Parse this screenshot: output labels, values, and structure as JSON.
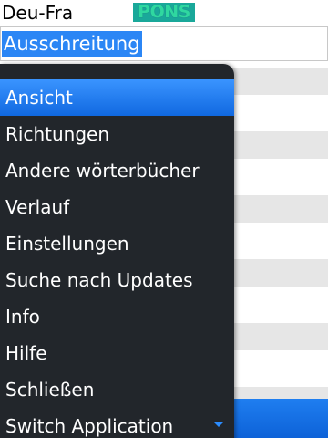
{
  "header": {
    "language_pair": "Deu-Fra",
    "logo_text": "PONS"
  },
  "search": {
    "value": "Ausschreitung"
  },
  "menu": {
    "items": [
      {
        "label": "Ansicht"
      },
      {
        "label": "Richtungen"
      },
      {
        "label": "Andere wörterbücher"
      },
      {
        "label": "Verlauf"
      },
      {
        "label": "Einstellungen"
      },
      {
        "label": "Suche nach Updates"
      },
      {
        "label": "Info"
      },
      {
        "label": "Hilfe"
      },
      {
        "label": "Schließen"
      },
      {
        "label": "Switch Application"
      }
    ],
    "selected_index": 0
  },
  "colors": {
    "accent": "#1f7ef0",
    "menu_background": "#22262b",
    "logo_background": "#1aa89a",
    "logo_text": "#2fd8a0"
  }
}
